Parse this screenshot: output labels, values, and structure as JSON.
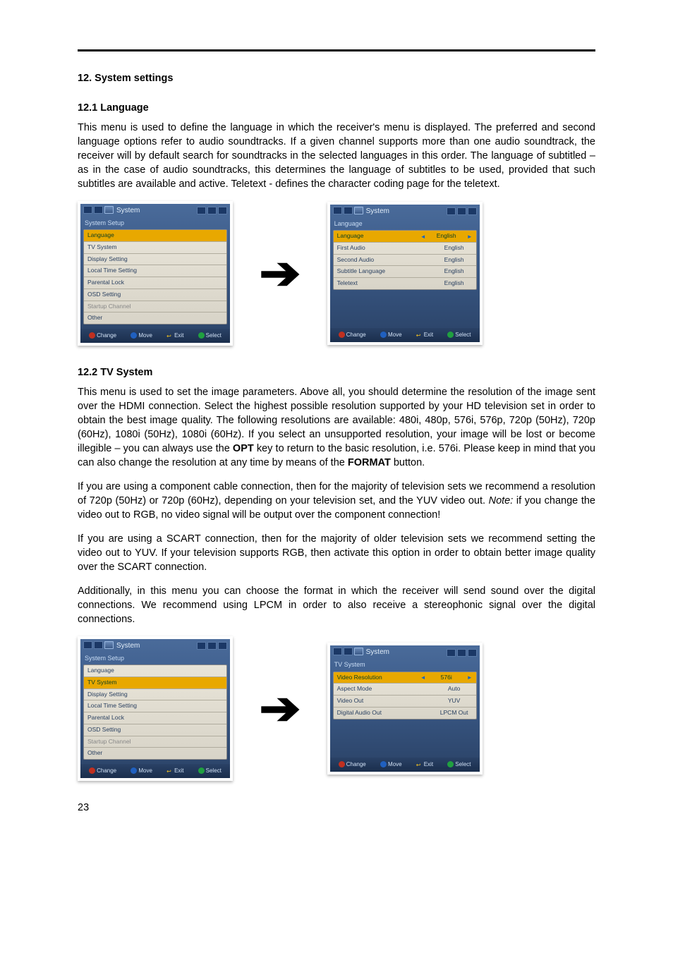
{
  "page_number": "23",
  "heading_12": "12. System settings",
  "heading_12_1": "12.1 Language",
  "para_12_1": "This menu is used to define the language in which the receiver's menu is displayed. The preferred and second language options refer to audio soundtracks. If a given channel supports more than one audio soundtrack, the receiver will by default search for soundtracks in the selected languages in this order. The language of subtitled – as in the case of audio soundtracks, this determines the language of subtitles to be used, provided that such subtitles are available and active. Teletext - defines the character coding page for the teletext.",
  "heading_12_2": "12.2 TV System",
  "para_12_2_a_pre": "This menu is used to set the image parameters. Above all, you should determine the resolution of the image sent over the HDMI connection. Select the highest possible resolution supported by your HD television set in order to obtain the best image quality. The following resolutions are available: 480i, 480p, 576i, 576p, 720p (50Hz), 720p (60Hz), 1080i (50Hz), 1080i (60Hz). If you select an unsupported resolution, your image will be lost or become illegible – you can always use the ",
  "para_12_2_a_bold1": "OPT",
  "para_12_2_a_mid": " key to return to the basic resolution, i.e. 576i. Please keep in mind that you can also change the resolution at any time by means of the ",
  "para_12_2_a_bold2": "FORMAT",
  "para_12_2_a_post": " button.",
  "para_12_2_b_pre": "If you are using a component cable connection, then for the majority of television sets we recommend a resolution of 720p (50Hz) or 720p (60Hz), depending on your television set, and the YUV video out. ",
  "para_12_2_b_note": "Note:",
  "para_12_2_b_post": " if you change the video out to RGB, no video signal will be output over the component connection!",
  "para_12_2_c": "If you are using a SCART connection, then for the majority of older television sets we recommend setting the video out to YUV. If your television supports RGB, then activate this option in order to obtain better image quality over the SCART connection.",
  "para_12_2_d": "Additionally, in this menu you can choose the format in which the receiver will send sound over the digital connections. We recommend using LPCM in order to also receive a stereophonic signal over the digital connections.",
  "osd": {
    "top_label": "System",
    "system_setup_title": "System Setup",
    "language_title": "Language",
    "tv_system_title": "TV System",
    "setup_items": {
      "language": "Language",
      "tv_system": "TV System",
      "display_setting": "Display Setting",
      "local_time_setting": "Local Time Setting",
      "parental_lock": "Parental Lock",
      "osd_setting": "OSD Setting",
      "startup_channel": "Startup Channel",
      "other": "Other"
    },
    "language_kv": {
      "language": {
        "k": "Language",
        "v": "English"
      },
      "first_audio": {
        "k": "First Audio",
        "v": "English"
      },
      "second_audio": {
        "k": "Second Audio",
        "v": "English"
      },
      "subtitle_language": {
        "k": "Subtitle Language",
        "v": "English"
      },
      "teletext": {
        "k": "Teletext",
        "v": "English"
      }
    },
    "tvsystem_kv": {
      "video_resolution": {
        "k": "Video Resolution",
        "v": "576i"
      },
      "aspect_mode": {
        "k": "Aspect Mode",
        "v": "Auto"
      },
      "video_out": {
        "k": "Video Out",
        "v": "YUV"
      },
      "digital_audio_out": {
        "k": "Digital Audio Out",
        "v": "LPCM Out"
      }
    },
    "footer": {
      "change": "Change",
      "move": "Move",
      "exit": "Exit",
      "select": "Select"
    }
  }
}
